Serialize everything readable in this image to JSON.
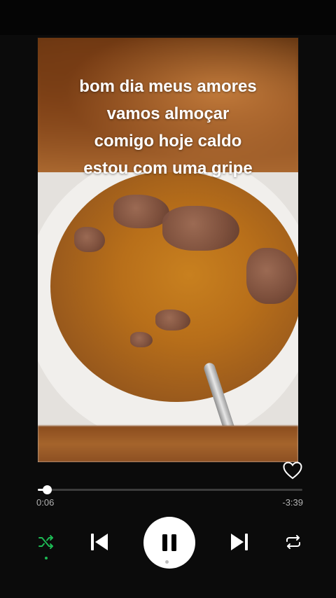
{
  "cover": {
    "caption_lines": [
      "bom dia meus amores",
      "vamos almoçar",
      "comigo hoje caldo",
      "estou com uma gripe"
    ]
  },
  "player": {
    "elapsed": "0:06",
    "remaining": "-3:39",
    "progress_fraction": 0.035,
    "liked": false,
    "is_playing": true,
    "shuffle_on": true
  },
  "icons": {
    "like": "heart-outline-icon",
    "shuffle": "shuffle-icon",
    "previous": "skip-previous-icon",
    "play_pause": "pause-icon",
    "next": "skip-next-icon",
    "repeat": "repeat-icon"
  },
  "colors": {
    "background": "#0b0b0b",
    "accent": "#1db954",
    "track": "#3c3c3c",
    "text_secondary": "#b3b3b3"
  }
}
